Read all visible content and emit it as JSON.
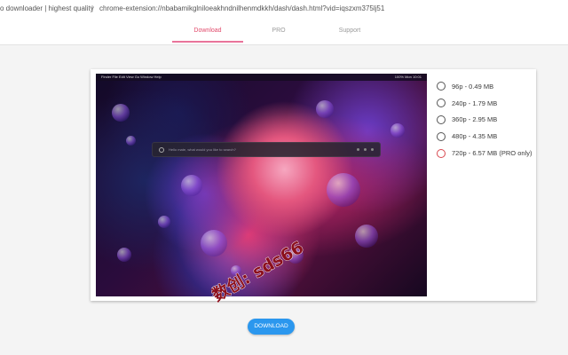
{
  "browser": {
    "tab_title": "o downloader | highest quality",
    "separator": "|",
    "url": "chrome-extension://nbabamikglniloeakhndnilhenmdkkh/dash/dash.html?vid=iqszxm375lj51"
  },
  "tabs": [
    {
      "label": "Download",
      "active": true
    },
    {
      "label": "PRO",
      "active": false
    },
    {
      "label": "Support",
      "active": false
    }
  ],
  "preview": {
    "menubar_left": "  Finder   File   Edit   View   Go   Window   Help",
    "menubar_right": "100%  Mon 10:01",
    "spotlight_placeholder": "Hello mate, what would you like to search?"
  },
  "qualities": [
    {
      "label": "96p - 0.49 MB",
      "pro": false
    },
    {
      "label": "240p - 1.79 MB",
      "pro": false
    },
    {
      "label": "360p - 2.95 MB",
      "pro": false
    },
    {
      "label": "480p - 4.35 MB",
      "pro": false
    },
    {
      "label": "720p - 6.57 MB (PRO only)",
      "pro": true
    }
  ],
  "download_label": "DOWNLOAD",
  "watermark_text": "数创: sds66",
  "colors": {
    "accent_tab": "#e14a6b",
    "button": "#2b97ee",
    "pro_radio": "#d8484f",
    "watermark": "#8b0f1c"
  }
}
